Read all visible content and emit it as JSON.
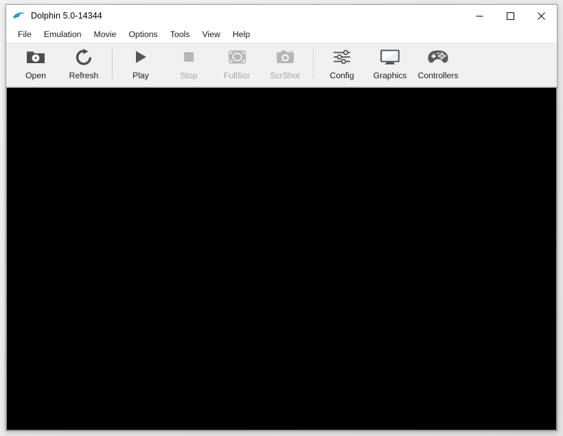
{
  "window": {
    "title": "Dolphin 5.0-14344",
    "app_icon": "dolphin-logo-icon",
    "controls": {
      "minimize_label": "—",
      "maximize_label": "□",
      "close_label": "✕"
    }
  },
  "menu": {
    "items": [
      {
        "label": "File"
      },
      {
        "label": "Emulation"
      },
      {
        "label": "Movie"
      },
      {
        "label": "Options"
      },
      {
        "label": "Tools"
      },
      {
        "label": "View"
      },
      {
        "label": "Help"
      }
    ]
  },
  "toolbar": {
    "buttons": [
      {
        "label": "Open",
        "icon": "open-folder-disc-icon",
        "enabled": true
      },
      {
        "label": "Refresh",
        "icon": "refresh-arrow-icon",
        "enabled": true
      },
      {
        "label": "Play",
        "icon": "play-triangle-icon",
        "enabled": true
      },
      {
        "label": "Stop",
        "icon": "stop-square-icon",
        "enabled": false
      },
      {
        "label": "FullScr",
        "icon": "fullscreen-icon",
        "enabled": false
      },
      {
        "label": "ScrShot",
        "icon": "camera-icon",
        "enabled": false
      },
      {
        "label": "Config",
        "icon": "sliders-icon",
        "enabled": true
      },
      {
        "label": "Graphics",
        "icon": "monitor-icon",
        "enabled": true
      },
      {
        "label": "Controllers",
        "icon": "gamepad-icon",
        "enabled": true
      }
    ]
  },
  "render": {
    "state": "blank",
    "background_color": "#000000"
  },
  "colors": {
    "accent": "#1f9fd4",
    "toolbar_background": "#f0f0f0",
    "window_background": "#ffffff",
    "enabled_text": "#1a1a1a",
    "disabled_text": "#a3a3a3"
  }
}
